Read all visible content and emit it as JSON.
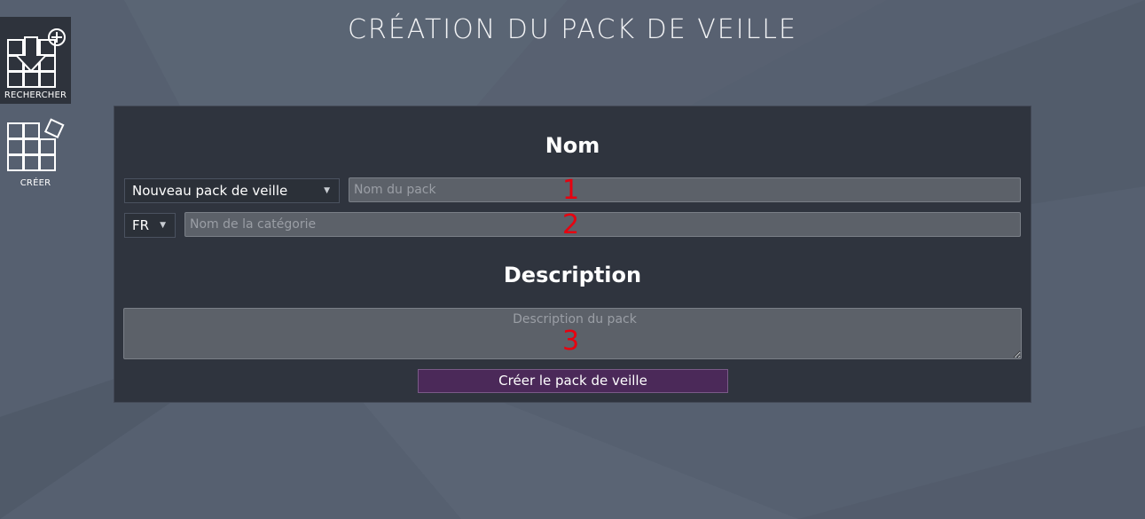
{
  "sidebar": {
    "search": {
      "label": "RECHERCHER",
      "icon": "grid-search-add-icon"
    },
    "create": {
      "label": "CRÉER",
      "icon": "grid-create-icon"
    }
  },
  "page": {
    "title": "CRÉATION DU PACK DE VEILLE"
  },
  "form": {
    "name_section_title": "Nom",
    "pack_select": {
      "value": "Nouveau pack de veille",
      "caret": "▼"
    },
    "pack_name_input": {
      "placeholder": "Nom du pack",
      "value": ""
    },
    "lang_select": {
      "value": "FR",
      "caret": "▼"
    },
    "category_input": {
      "placeholder": "Nom de la catégorie",
      "value": ""
    },
    "description_section_title": "Description",
    "description_textarea": {
      "placeholder": "Description du pack",
      "value": ""
    },
    "submit_label": "Créer le pack de veille"
  },
  "markers": [
    "1",
    "2",
    "3"
  ],
  "colors": {
    "background": "#566070",
    "panel": "#2f343e",
    "input": "#5c6169",
    "submit": "#4b2959",
    "marker": "#e8000f"
  }
}
